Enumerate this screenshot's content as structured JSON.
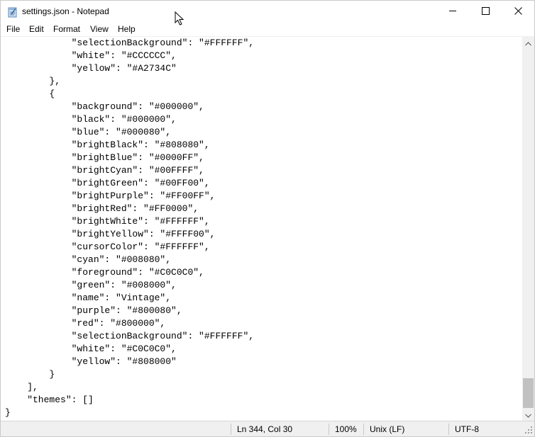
{
  "window": {
    "title": "settings.json - Notepad",
    "icon": "notepad-icon",
    "controls": [
      "minimize-icon",
      "maximize-icon",
      "close-icon"
    ]
  },
  "menu": [
    "File",
    "Edit",
    "Format",
    "View",
    "Help"
  ],
  "editor": {
    "lines": [
      "            \"selectionBackground\": \"#FFFFFF\",",
      "            \"white\": \"#CCCCCC\",",
      "            \"yellow\": \"#A2734C\"",
      "        },",
      "        {",
      "            \"background\": \"#000000\",",
      "            \"black\": \"#000000\",",
      "            \"blue\": \"#000080\",",
      "            \"brightBlack\": \"#808080\",",
      "            \"brightBlue\": \"#0000FF\",",
      "            \"brightCyan\": \"#00FFFF\",",
      "            \"brightGreen\": \"#00FF00\",",
      "            \"brightPurple\": \"#FF00FF\",",
      "            \"brightRed\": \"#FF0000\",",
      "            \"brightWhite\": \"#FFFFFF\",",
      "            \"brightYellow\": \"#FFFF00\",",
      "            \"cursorColor\": \"#FFFFFF\",",
      "            \"cyan\": \"#008080\",",
      "            \"foreground\": \"#C0C0C0\",",
      "            \"green\": \"#008000\",",
      "            \"name\": \"Vintage\",",
      "            \"purple\": \"#800080\",",
      "            \"red\": \"#800000\",",
      "            \"selectionBackground\": \"#FFFFFF\",",
      "            \"white\": \"#C0C0C0\",",
      "            \"yellow\": \"#808000\"",
      "        }",
      "    ],",
      "    \"themes\": []",
      "}"
    ]
  },
  "status": {
    "position": "Ln 344, Col 30",
    "zoom": "100%",
    "line_ending": "Unix (LF)",
    "encoding": "UTF-8"
  },
  "colors": {
    "statusbar_bg": "#f0f0f0",
    "scrollbar_thumb": "#c1c1c1"
  }
}
